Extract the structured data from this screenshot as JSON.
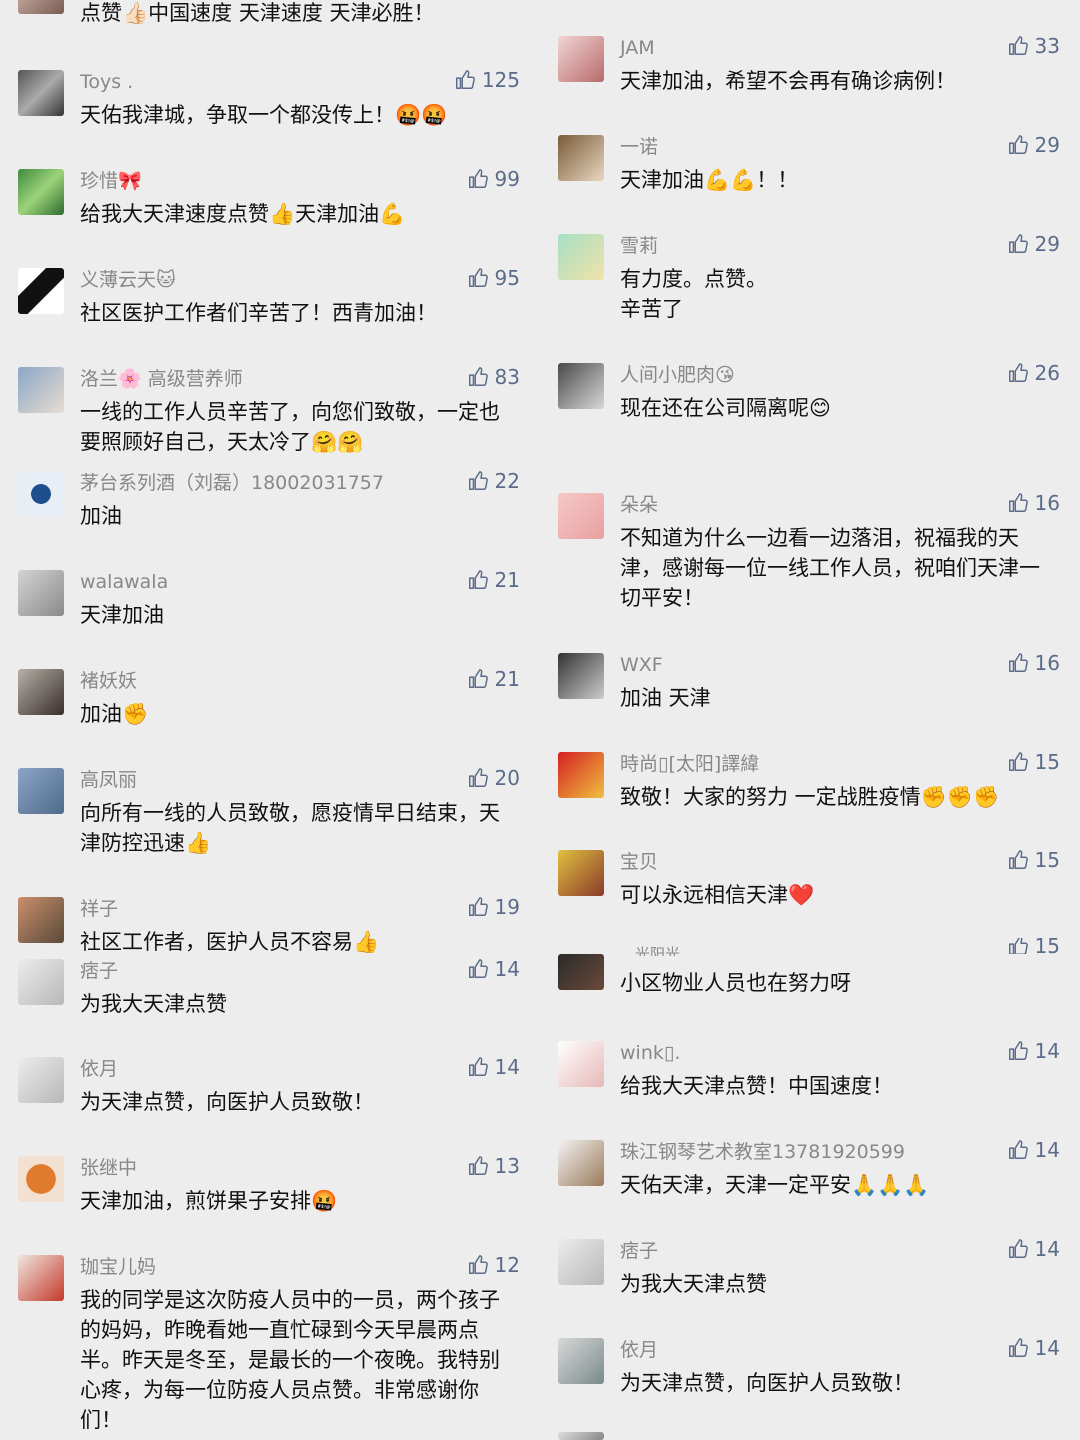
{
  "left": [
    {
      "name": "",
      "text": "点赞👍🏻中国速度 天津速度 天津必胜！",
      "likes": ""
    },
    {
      "name": "Toys .",
      "text": "天佑我津城，争取一个都没传上！🤬🤬",
      "likes": "125"
    },
    {
      "name": "珍惜🎀",
      "text": "给我大天津速度点赞👍天津加油💪",
      "likes": "99"
    },
    {
      "name": "义薄云天🐱",
      "text": "社区医护工作者们辛苦了！西青加油！",
      "likes": "95"
    },
    {
      "name": "洛兰🌸 高级营养师",
      "text": "一线的工作人员辛苦了，向您们致敬，一定也要照顾好自己，天太冷了🤗🤗",
      "likes": "83"
    },
    {
      "name": "茅台系列酒（刘磊）18002031757",
      "text": "加油",
      "likes": "22"
    },
    {
      "name": "walawala",
      "text": "天津加油",
      "likes": "21"
    },
    {
      "name": "褚妖妖",
      "text": "加油✊",
      "likes": "21"
    },
    {
      "name": "高凤丽",
      "text": "向所有一线的人员致敬，愿疫情早日结束，天津防控迅速👍",
      "likes": "20"
    },
    {
      "name": "祥子",
      "text": "社区工作者，医护人员不容易👍",
      "likes": "19"
    },
    {
      "name": "痞子",
      "text": "为我大天津点赞",
      "likes": "14"
    },
    {
      "name": "依月",
      "text": "为天津点赞，向医护人员致敬！",
      "likes": "14"
    },
    {
      "name": "张继中",
      "text": "天津加油，煎饼果子安排🤬",
      "likes": "13"
    },
    {
      "name": "珈宝儿妈",
      "text": "我的同学是这次防疫人员中的一员，两个孩子的妈妈，昨晚看她一直忙碌到今天早晨两点半。昨天是冬至，是最长的一个夜晚。我特别心疼，为每一位防疫人员点赞。非常感谢你们！",
      "likes": "12"
    }
  ],
  "right": [
    {
      "name": "JAM",
      "text": "天津加油，希望不会再有确诊病例！",
      "likes": "33"
    },
    {
      "name": "一诺",
      "text": "天津加油💪💪！！",
      "likes": "29"
    },
    {
      "name": "雪莉",
      "text": "有力度。点赞。辛苦了",
      "likes": "29"
    },
    {
      "name": "人间小肥肉😘",
      "text": "现在还在公司隔离呢😊",
      "likes": "26"
    },
    {
      "name": "朵朵",
      "text": "不知道为什么一边看一边落泪，祝福我的天津，感谢每一位一线工作人员，祝咱们天津一切平安！",
      "likes": "16"
    },
    {
      "name": "WXF",
      "text": "加油 天津",
      "likes": "16"
    },
    {
      "name": "時尚▯[太阳]譯緯",
      "text": "致敬！大家的努力 一定战胜疫情✊✊✊",
      "likes": "15"
    },
    {
      "name": "宝贝",
      "text": "可以永远相信天津❤️",
      "likes": "15"
    },
    {
      "name": "、光阳光",
      "text": "小区物业人员也在努力呀",
      "likes": "15"
    },
    {
      "name": "wink▯.",
      "text": "给我大天津点赞！中国速度！",
      "likes": "14"
    },
    {
      "name": "珠江钢琴艺术教室13781920599",
      "text": "天佑天津，天津一定平安🙏🙏🙏",
      "likes": "14"
    },
    {
      "name": "痞子",
      "text": "为我大天津点赞",
      "likes": "14"
    },
    {
      "name": "依月",
      "text": "为天津点赞，向医护人员致敬！",
      "likes": "14"
    }
  ],
  "colors": {
    "background": "#ededed",
    "name": "#888888",
    "text": "#111111",
    "like": "#5b6b8a"
  },
  "icons": {
    "like": "thumbs-up-outline-icon"
  }
}
